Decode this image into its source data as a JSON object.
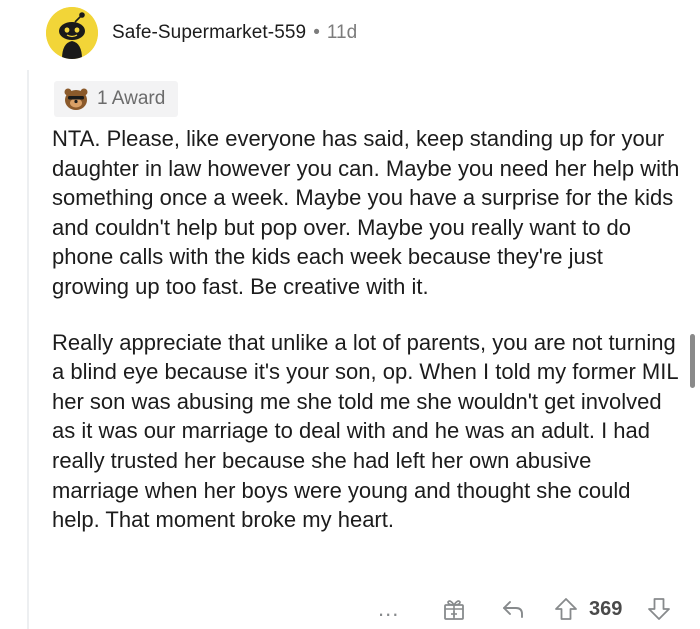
{
  "comment": {
    "author": "Safe-Supermarket-559",
    "separator": "•",
    "age": "11d",
    "award_label": "1 Award",
    "paragraphs": [
      "NTA. Please, like everyone has said, keep standing up for your daughter in law however you can. Maybe you need her help with something once a week. Maybe you have a surprise for the kids and couldn't help but pop over. Maybe you really want to do phone calls with the kids each week because they're just growing up too fast. Be creative with it.",
      "Really appreciate that unlike a lot of parents, you are not turning a blind eye because it's your son, op. When I told my former MIL her son was abusing me she told me she wouldn't get involved as it was our marriage to deal with and he was an adult. I had really trusted her because she had left her own abusive marriage when her boys were young and thought she could help. That moment broke my heart."
    ]
  },
  "footer": {
    "more_label": "...",
    "score": "369"
  },
  "icons": {
    "avatar": "snoo-avatar",
    "award": "award-icon",
    "more": "more-options-icon",
    "gift": "gift-award-icon",
    "reply": "reply-icon",
    "upvote": "upvote-icon",
    "downvote": "downvote-icon"
  },
  "colors": {
    "avatar_bg": "#f2d538",
    "muted_text": "#7c7c7c",
    "icon_gray": "#878a8c",
    "award_bg": "#f3f3f4"
  }
}
